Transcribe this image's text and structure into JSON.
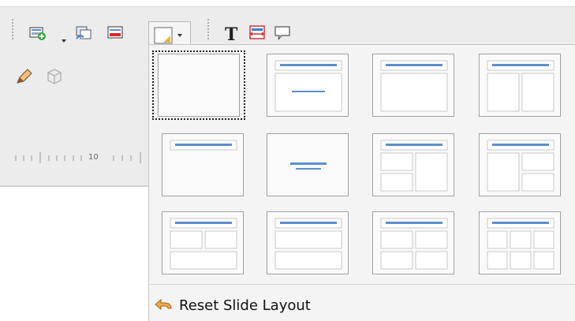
{
  "toolbar": {
    "icons": [
      "new-slide-icon",
      "duplicate-slide-icon",
      "delete-slide-icon",
      "slide-layout-icon",
      "text-icon",
      "fit-text-icon",
      "callout-icon"
    ],
    "second_row_icons": [
      "pencil-icon",
      "3d-object-icon"
    ]
  },
  "ruler": {
    "label": "10"
  },
  "layout_panel": {
    "layouts": [
      {
        "name": "blank-slide",
        "type": "blank",
        "selected": true
      },
      {
        "name": "title-content",
        "type": "title-content",
        "selected": false
      },
      {
        "name": "title-content-box",
        "type": "title-box",
        "selected": false
      },
      {
        "name": "title-two-content",
        "type": "title-two-columns",
        "selected": false
      },
      {
        "name": "title-only",
        "type": "title-only",
        "selected": false
      },
      {
        "name": "centered-text",
        "type": "centered-text",
        "selected": false
      },
      {
        "name": "title-two-content-left",
        "type": "title-left-two-right-one",
        "selected": false
      },
      {
        "name": "title-two-content-right",
        "type": "title-left-one-right-two",
        "selected": false
      },
      {
        "name": "title-two-content-over",
        "type": "title-two-over-one",
        "selected": false
      },
      {
        "name": "title-content-over-content",
        "type": "title-two-rows",
        "selected": false
      },
      {
        "name": "title-four-content",
        "type": "title-four",
        "selected": false
      },
      {
        "name": "title-six-content",
        "type": "title-six",
        "selected": false
      }
    ],
    "reset_label": "Reset Slide Layout"
  },
  "colors": {
    "accent_blue": "#5b8fce",
    "panel_bg": "#f4f4f4",
    "toolbar_bg": "#ececec"
  }
}
